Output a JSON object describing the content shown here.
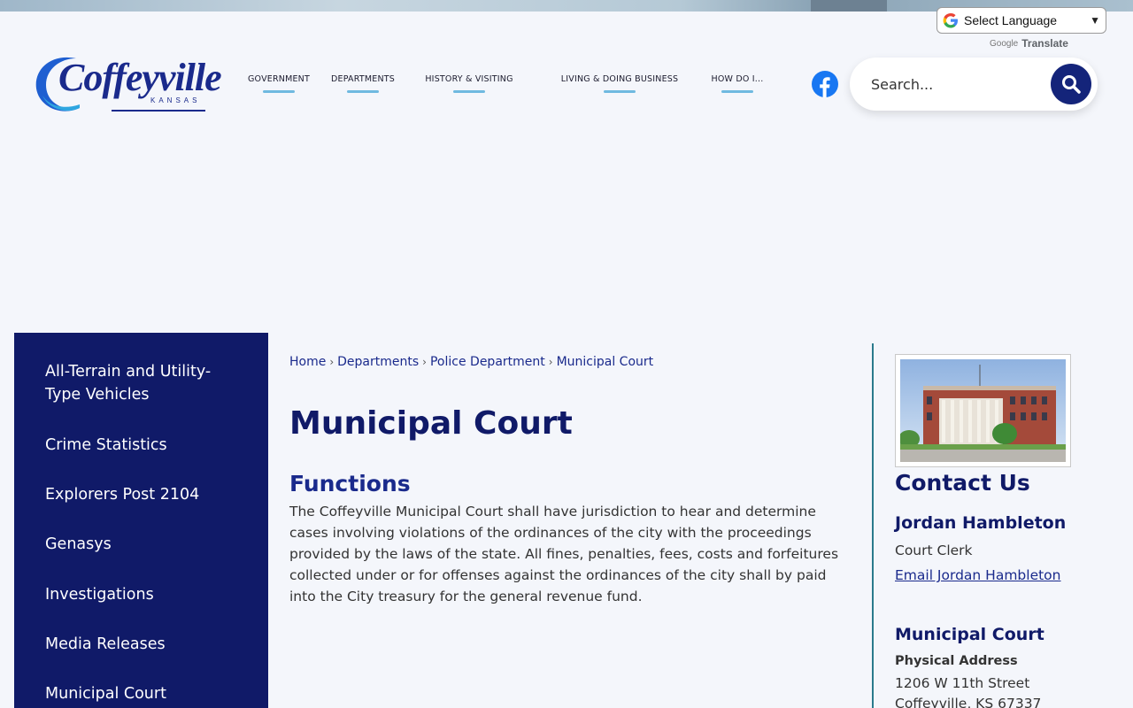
{
  "translate": {
    "select_label": "Select Language",
    "powered_by": "Google",
    "translate_word": "Translate"
  },
  "logo": {
    "name": "Coffeyville",
    "state": "KANSAS"
  },
  "nav": [
    {
      "label": "GOVERNMENT"
    },
    {
      "label": "DEPARTMENTS"
    },
    {
      "label": "HISTORY & VISITING"
    },
    {
      "label": "LIVING & DOING BUSINESS"
    },
    {
      "label": "HOW DO I..."
    }
  ],
  "search": {
    "placeholder": "Search..."
  },
  "sidebar": {
    "items": [
      {
        "label": "All-Terrain and Utility-Type Vehicles"
      },
      {
        "label": "Crime Statistics"
      },
      {
        "label": "Explorers Post 2104"
      },
      {
        "label": "Genasys"
      },
      {
        "label": "Investigations"
      },
      {
        "label": "Media Releases"
      },
      {
        "label": "Municipal Court"
      }
    ]
  },
  "breadcrumb": {
    "items": [
      "Home",
      "Departments",
      "Police Department",
      "Municipal Court"
    ],
    "separator": "›"
  },
  "page": {
    "title": "Municipal Court",
    "section_title": "Functions",
    "body": "The Coffeyville Municipal Court shall have jurisdiction to hear and determine cases involving violations of the ordinances of the city with the proceedings provided by the laws of the state. All fines, penalties, fees, costs and forfeitures collected under or for offenses against the ordinances of the city shall by paid into the City treasury for the general revenue fund."
  },
  "contact": {
    "title": "Contact Us",
    "name": "Jordan Hambleton",
    "role": "Court Clerk",
    "email_label": "Email Jordan Hambleton",
    "office_title": "Municipal Court",
    "address_label": "Physical Address",
    "address_line1": "1206 W 11th Street",
    "address_line2": "Coffeyville, KS 67337"
  },
  "colors": {
    "navy": "#101a68",
    "accent_blue": "#1a2a8c",
    "nav_underline": "#6fb9e0",
    "divider": "#2a7a8c"
  }
}
